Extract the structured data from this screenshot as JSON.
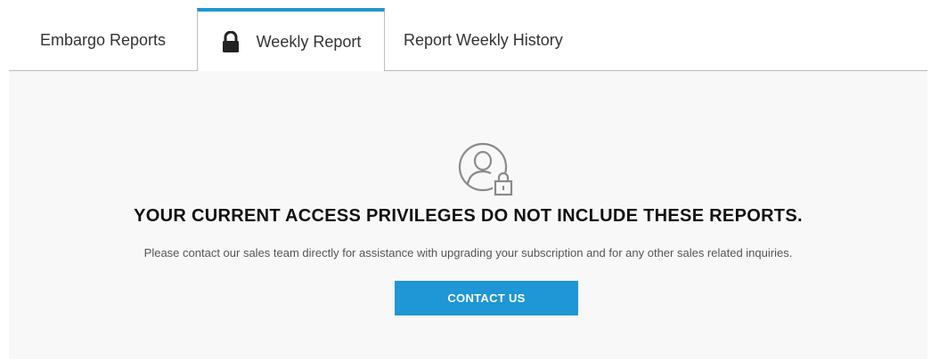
{
  "tabs": [
    {
      "label": "Embargo Reports",
      "active": false
    },
    {
      "label": "Weekly Report",
      "active": true,
      "icon": "lock-icon"
    },
    {
      "label": "Report Weekly History",
      "active": false
    }
  ],
  "notice": {
    "icon": "user-lock-icon",
    "heading": "YOUR CURRENT ACCESS PRIVILEGES DO NOT INCLUDE THESE REPORTS.",
    "message": "Please contact our sales team directly for assistance with upgrading your subscription and for any other sales related inquiries.",
    "button_label": "CONTACT US"
  },
  "colors": {
    "accent": "#1f96d5",
    "content_bg": "#f8f8f8",
    "border": "#bdbdbd"
  }
}
